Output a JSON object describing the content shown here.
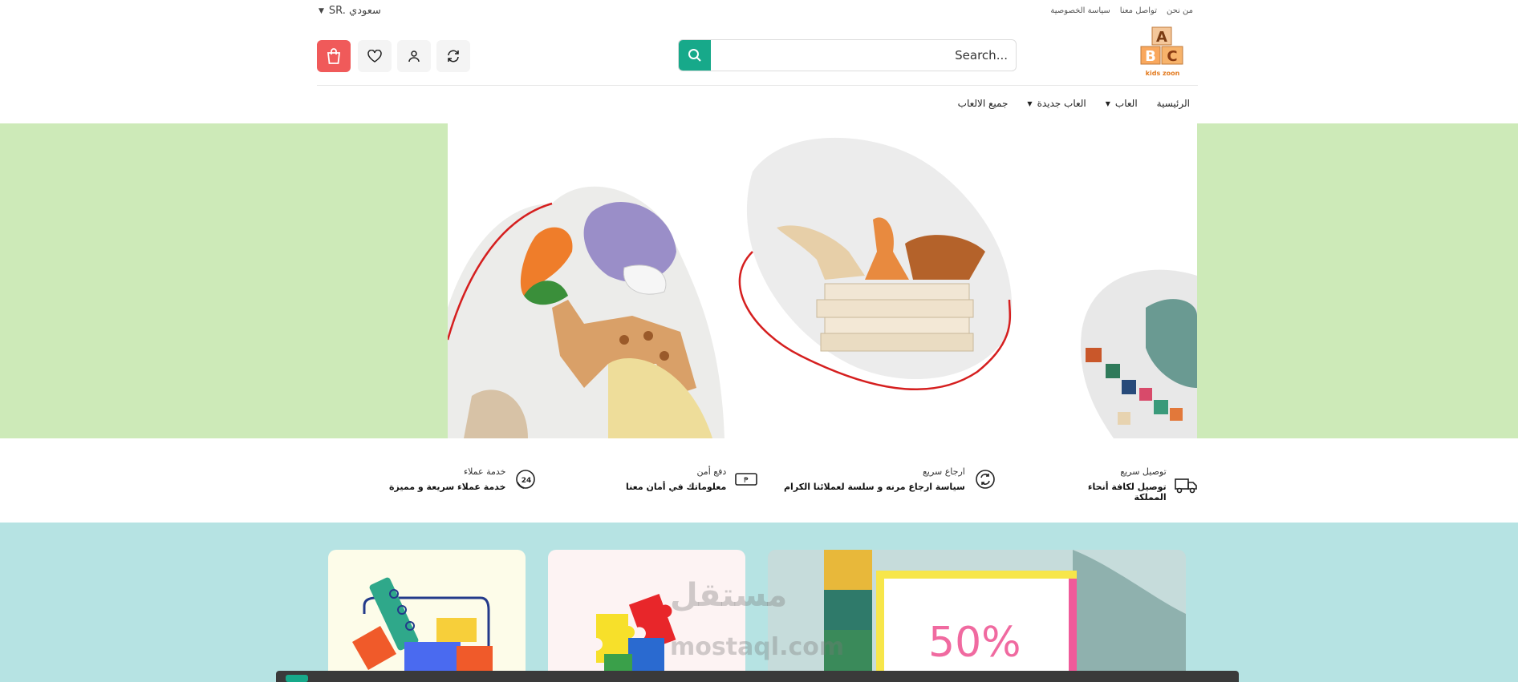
{
  "topbar": {
    "currency": "SR. سعودي",
    "links": [
      "من نحن",
      "تواصل معنا",
      "سياسة الخصوصية"
    ]
  },
  "header": {
    "search_placeholder": "Search...",
    "logo_letters": [
      "A",
      "B",
      "C"
    ],
    "logo_text": "kids zoon",
    "icons": [
      "cart-icon",
      "heart-icon",
      "user-icon",
      "refresh-icon",
      "search-icon"
    ],
    "colors": {
      "accent": "#17a98a",
      "cart": "#f05a5a"
    }
  },
  "nav": {
    "items": [
      {
        "label": "الرئيسية",
        "has_dropdown": false
      },
      {
        "label": "العاب",
        "has_dropdown": true
      },
      {
        "label": "العاب جديدة",
        "has_dropdown": true
      },
      {
        "label": "جميع الالعاب",
        "has_dropdown": false
      }
    ]
  },
  "features": [
    {
      "title": "توصيل سريع",
      "desc": "توصيل لكافة أنحاء المملكة",
      "icon": "truck-icon"
    },
    {
      "title": "ارجاع سريع",
      "desc": "سياسة ارجاع مرنه و سلسة لعملائنا الكرام",
      "icon": "return-icon"
    },
    {
      "title": "دفع أمن",
      "desc": "معلوماتك في أمان معنا",
      "icon": "payment-icon"
    },
    {
      "title": "خدمة عملاء",
      "desc": "خدمة عملاء سريعة و مميزة",
      "icon": "support-24-icon"
    }
  ],
  "banners": {
    "promo_text": "50%"
  },
  "watermark": {
    "line1": "مستقل",
    "line2": "mostaql.com"
  }
}
